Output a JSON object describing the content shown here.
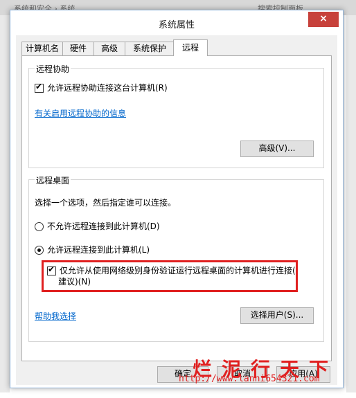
{
  "background": {
    "text_left": "系统和安全 › 系统",
    "text_right": "搜索控制面板"
  },
  "dialog": {
    "title": "系统属性",
    "close_glyph": "×"
  },
  "tabs": [
    {
      "label": "计算机名"
    },
    {
      "label": "硬件"
    },
    {
      "label": "高级"
    },
    {
      "label": "系统保护"
    },
    {
      "label": "远程",
      "active": true
    }
  ],
  "remote_assistance": {
    "title": "远程协助",
    "allow_checkbox_label": "允许远程协助连接这台计算机(R)",
    "allow_checked": true,
    "info_link": "有关启用远程协助的信息",
    "advanced_button": "高级(V)..."
  },
  "remote_desktop": {
    "title": "远程桌面",
    "instruction": "选择一个选项，然后指定谁可以连接。",
    "option_disallow": "不允许远程连接到此计算机(D)",
    "option_allow": "允许远程连接到此计算机(L)",
    "selected": "allow",
    "nla_line1": "仅允许从使用网络级别身份验证运行远程桌面的计算机进行连接(",
    "nla_line2": "建议)(N)",
    "nla_checked": true,
    "help_link": "帮助我选择",
    "select_users_button": "选择用户(S)..."
  },
  "footer": {
    "ok": "确定",
    "cancel": "取消",
    "apply": "应用(A)"
  },
  "watermark": {
    "chars": "烂泥行天下",
    "url": "http://www.lanni654321.com"
  },
  "colors": {
    "highlight": "#e02020",
    "link": "#0066cc",
    "close": "#c7413b"
  }
}
